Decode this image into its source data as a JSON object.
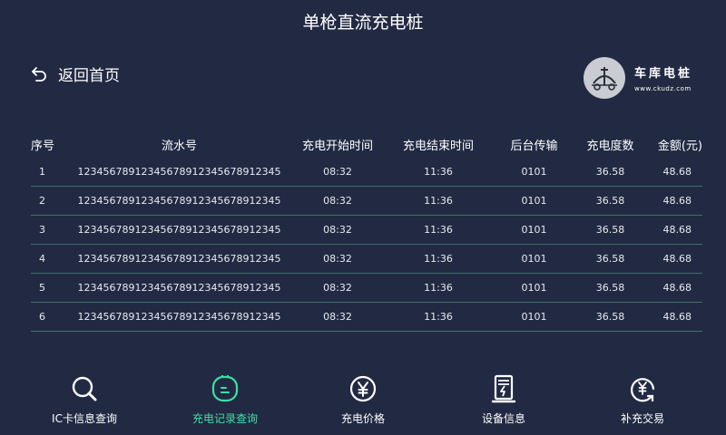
{
  "header": {
    "title": "单枪直流充电桩"
  },
  "back": {
    "label": "返回首页"
  },
  "logo": {
    "name": "车库电桩",
    "url": "www.ckudz.com"
  },
  "table": {
    "columns": [
      "序号",
      "流水号",
      "充电开始时间",
      "充电结束时间",
      "后台传输",
      "充电度数",
      "金额(元)"
    ],
    "rows": [
      [
        "1",
        "12345678912345678912345678912345",
        "08:32",
        "11:36",
        "0101",
        "36.58",
        "48.68"
      ],
      [
        "2",
        "12345678912345678912345678912345",
        "08:32",
        "11:36",
        "0101",
        "36.58",
        "48.68"
      ],
      [
        "3",
        "12345678912345678912345678912345",
        "08:32",
        "11:36",
        "0101",
        "36.58",
        "48.68"
      ],
      [
        "4",
        "12345678912345678912345678912345",
        "08:32",
        "11:36",
        "0101",
        "36.58",
        "48.68"
      ],
      [
        "5",
        "12345678912345678912345678912345",
        "08:32",
        "11:36",
        "0101",
        "36.58",
        "48.68"
      ],
      [
        "6",
        "12345678912345678912345678912345",
        "08:32",
        "11:36",
        "0101",
        "36.58",
        "48.68"
      ]
    ]
  },
  "nav": {
    "items": [
      {
        "label": "IC卡信息查询",
        "icon": "search-icon",
        "active": false
      },
      {
        "label": "充电记录查询",
        "icon": "record-icon",
        "active": true
      },
      {
        "label": "充电价格",
        "icon": "yuan-icon",
        "active": false
      },
      {
        "label": "设备信息",
        "icon": "charger-device-icon",
        "active": false
      },
      {
        "label": "补充交易",
        "icon": "transaction-icon",
        "active": false
      }
    ]
  },
  "colors": {
    "background": "#222a43",
    "accent": "#3ee0a6",
    "divider": "#3f6f72"
  }
}
